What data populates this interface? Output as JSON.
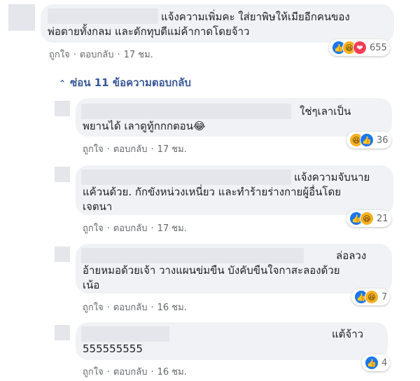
{
  "main_comment": {
    "text_line1": "แจ้งความเพิ่มคะ ใส่ยาพิษให้เมียอีกคนของ",
    "text_line2": "พ่อตายทั้งกลม และดักทุบตีแม่ค้ากาดโดยจ้าว",
    "like": "ถูกใจ",
    "reply": "ตอบกลับ",
    "time": "17 ชม.",
    "reaction_count": "655"
  },
  "hide_replies": "ซ่อน 11 ข้อความตอบกลับ",
  "replies": [
    {
      "line1": "ใช่ๆเลาเป็น",
      "line2": "พยานได้ เลาดูทู้กกกตอน😂",
      "like": "ถูกใจ",
      "reply": "ตอบกลับ",
      "time": "17 ชม.",
      "reaction_count": "36"
    },
    {
      "line1": "แจ้งความจับนาย",
      "line2": "แค้วนด้วย. กักขังหน่วงเหนี่ยว และทำร้ายร่างกายผู้อื่นโดย",
      "line3": "เจตนา",
      "like": "ถูกใจ",
      "reply": "ตอบกลับ",
      "time": "17 ชม.",
      "reaction_count": "21"
    },
    {
      "line1": "ล่อลวง",
      "line2": "อ้ายหมอด้วยเจ้า วางแผนข่มขืน บังคับขืนใจกาสะลองด้วย",
      "line3": "เน้อ",
      "like": "ถูกใจ",
      "reply": "ตอบกลับ",
      "time": "16 ชม.",
      "reaction_count": "7"
    },
    {
      "line1": "แต้จ้าว",
      "line2": "555555555",
      "like": "ถูกใจ",
      "reply": "ตอบกลับ",
      "time": "16 ชม.",
      "reaction_count": "4"
    }
  ],
  "icons": {
    "like": "👍",
    "haha": "😆",
    "love": "❤",
    "chevron": "⌃"
  },
  "colors": {
    "link": "#385898",
    "like_blue": "#1877f2",
    "bubble": "#f0f2f5"
  }
}
